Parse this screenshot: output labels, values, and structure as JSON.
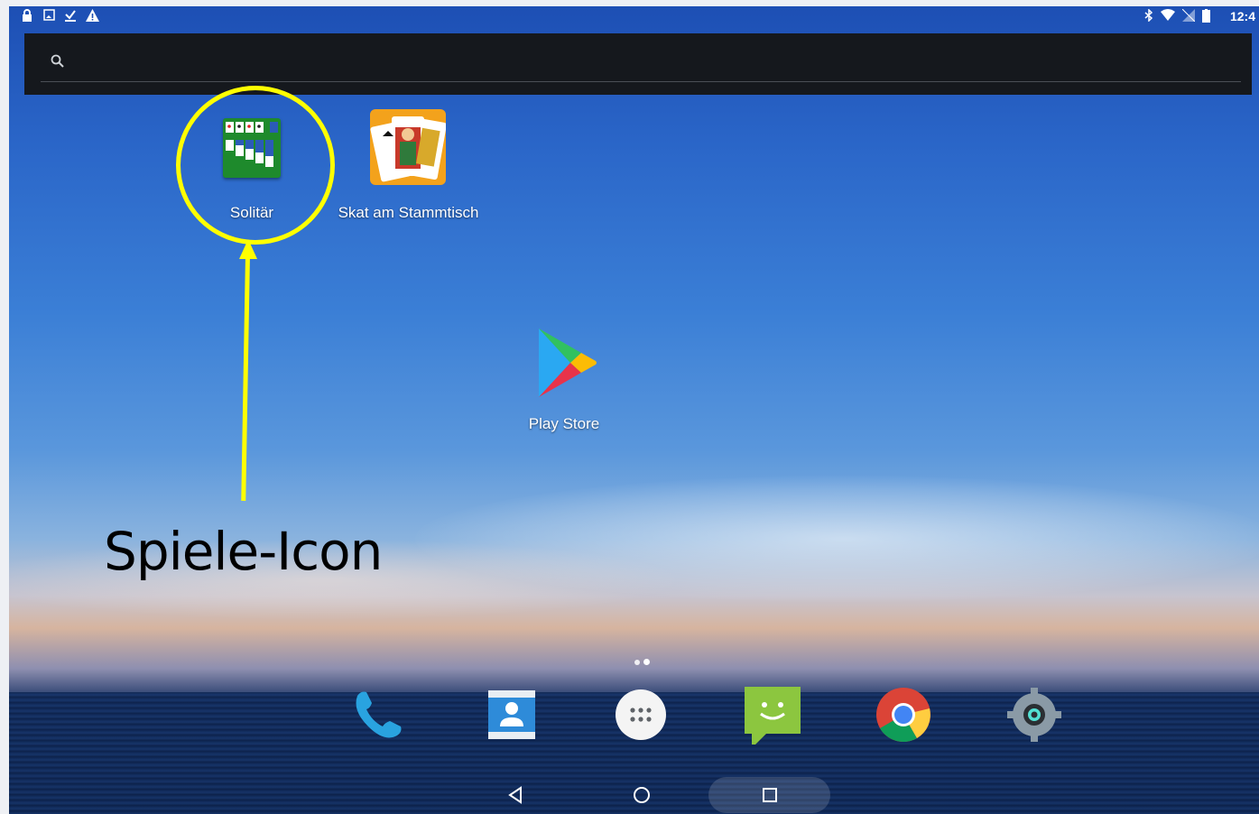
{
  "statusbar": {
    "left_icons": [
      "lock-icon",
      "image-icon",
      "download-done-icon",
      "warning-icon"
    ],
    "right_icons": [
      "bluetooth-icon",
      "wifi-icon",
      "no-sim-icon",
      "battery-icon"
    ],
    "clock": "12:4"
  },
  "search": {
    "icon": "search-icon"
  },
  "desktop": {
    "apps": [
      {
        "label": "Solitär",
        "icon": "solitaire-icon"
      },
      {
        "label": "Skat am Stammtisch",
        "icon": "skat-cards-icon"
      },
      {
        "label": "Play Store",
        "icon": "play-store-icon"
      }
    ]
  },
  "annotation": {
    "callout": "Spiele-Icon",
    "color": "#ffff00"
  },
  "dock": {
    "items": [
      "phone-icon",
      "contacts-icon",
      "app-drawer-icon",
      "messaging-icon",
      "chrome-icon",
      "settings-icon"
    ]
  },
  "navbar": {
    "buttons": [
      "back-icon",
      "home-icon",
      "recents-icon"
    ]
  }
}
